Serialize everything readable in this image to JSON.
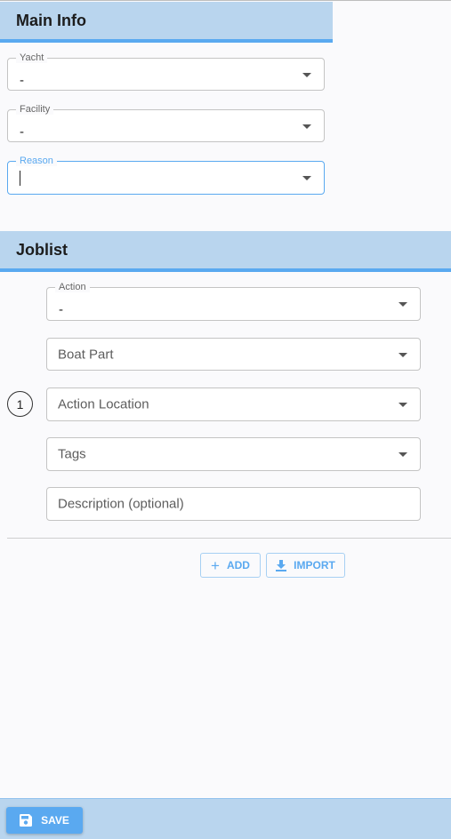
{
  "main_info": {
    "title": "Main Info",
    "yacht": {
      "label": "Yacht",
      "value": "-"
    },
    "facility": {
      "label": "Facility",
      "value": "-"
    },
    "reason": {
      "label": "Reason",
      "value": ""
    }
  },
  "joblist": {
    "title": "Joblist",
    "items": [
      {
        "index": "1",
        "action": {
          "label": "Action",
          "value": "-"
        },
        "boat_part": {
          "placeholder": "Boat Part"
        },
        "action_location": {
          "placeholder": "Action Location"
        },
        "tags": {
          "placeholder": "Tags"
        },
        "description": {
          "placeholder": "Description (optional)"
        }
      }
    ],
    "add_label": "ADD",
    "import_label": "IMPORT"
  },
  "footer": {
    "save_label": "SAVE"
  },
  "colors": {
    "accent": "#5aa9f0",
    "header_bg": "#b9d5ee",
    "page_bg": "#fafafc"
  }
}
